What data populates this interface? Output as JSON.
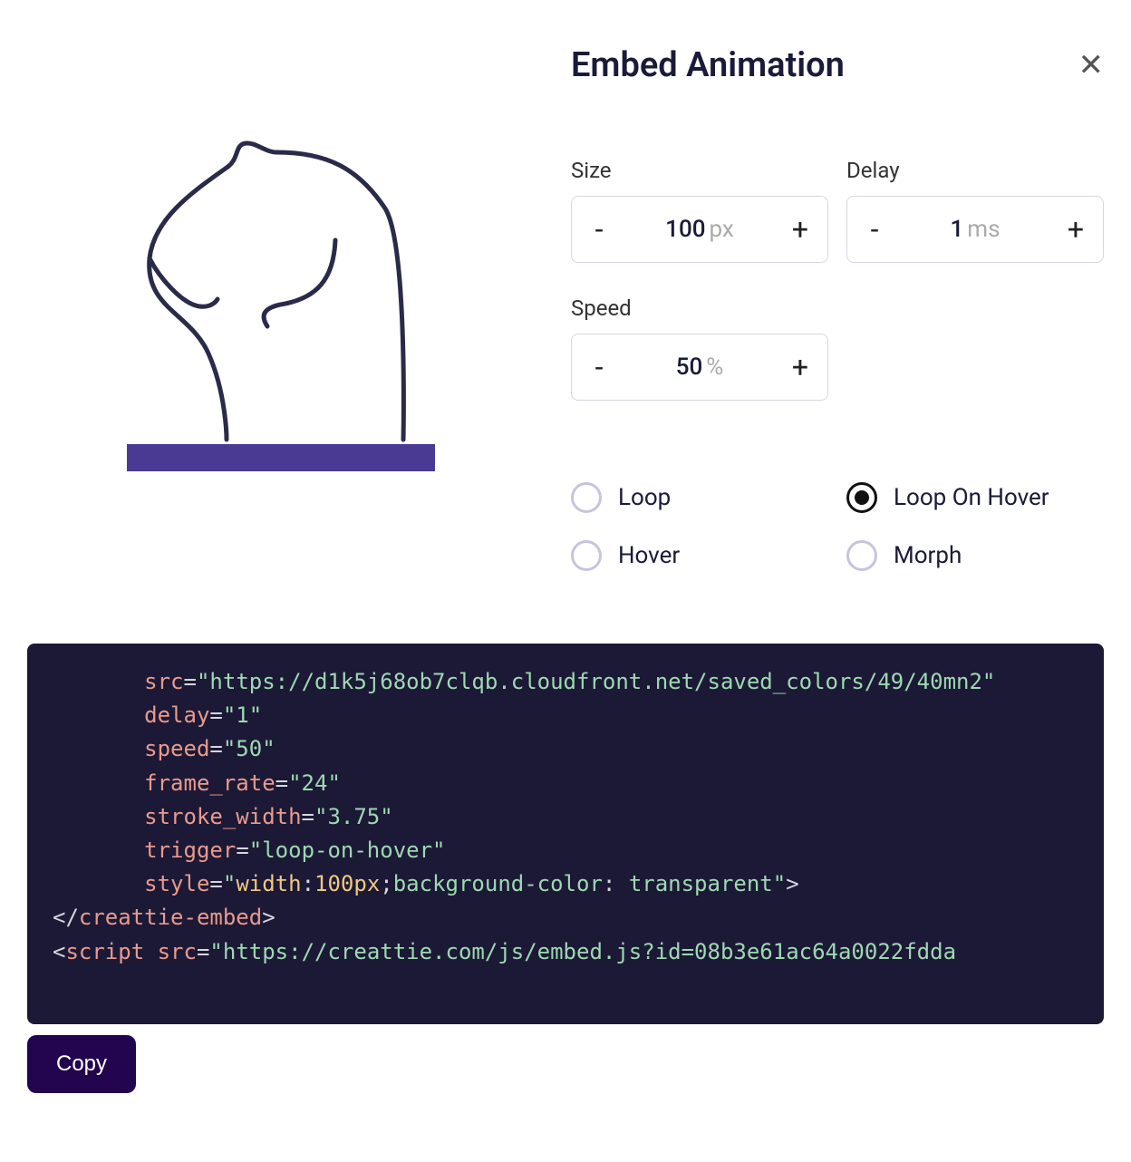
{
  "title": "Embed Animation",
  "controls": {
    "size": {
      "label": "Size",
      "value": "100",
      "unit": "px"
    },
    "delay": {
      "label": "Delay",
      "value": "1",
      "unit": "ms"
    },
    "speed": {
      "label": "Speed",
      "value": "50",
      "unit": "%"
    }
  },
  "triggers": {
    "loop": "Loop",
    "loop_on_hover": "Loop On Hover",
    "hover": "Hover",
    "morph": "Morph",
    "selected": "loop_on_hover"
  },
  "code": {
    "indent": "       ",
    "attrs": {
      "src": "https://d1k5j68ob7clqb.cloudfront.net/saved_colors/49/40mn2",
      "delay": "1",
      "speed": "50",
      "frame_rate": "24",
      "stroke_width": "3.75",
      "trigger": "loop-on-hover",
      "style": "width:100px;background-color: transparent"
    },
    "close_tag": "creattie-embed",
    "script_tag": "script",
    "script_attr": "src",
    "script_src": "https://creattie.com/js/embed.js?id=08b3e61ac64a0022fdda"
  },
  "copy_label": "Copy",
  "colors": {
    "accent": "#4a3a94",
    "dark": "#23044e"
  }
}
